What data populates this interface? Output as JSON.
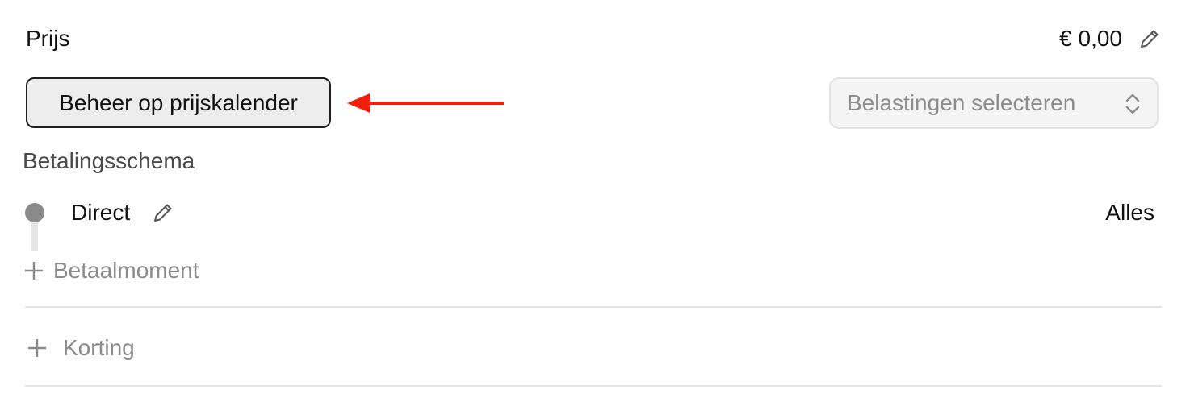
{
  "price": {
    "label": "Prijs",
    "value": "€ 0,00",
    "edit_icon": "pencil-icon"
  },
  "price_calendar_button": {
    "label": "Beheer op prijskalender"
  },
  "annotation": {
    "arrow_color": "#f21f0a"
  },
  "tax_select": {
    "placeholder": "Belastingen selecteren",
    "icon": "chevron-updown-icon"
  },
  "payment_schedule": {
    "label": "Betalingsschema",
    "moments": [
      {
        "name": "Direct",
        "amount": "Alles",
        "edit_icon": "pencil-icon"
      }
    ],
    "add_label": "Betaalmoment"
  },
  "discount": {
    "add_label": "Korting"
  },
  "colors": {
    "text": "#111111",
    "muted": "#8a8a8a",
    "button_bg": "#ededed",
    "select_bg": "#f4f4f4",
    "timeline_dot": "#8a8a8a",
    "divider": "#e5e5e5"
  }
}
